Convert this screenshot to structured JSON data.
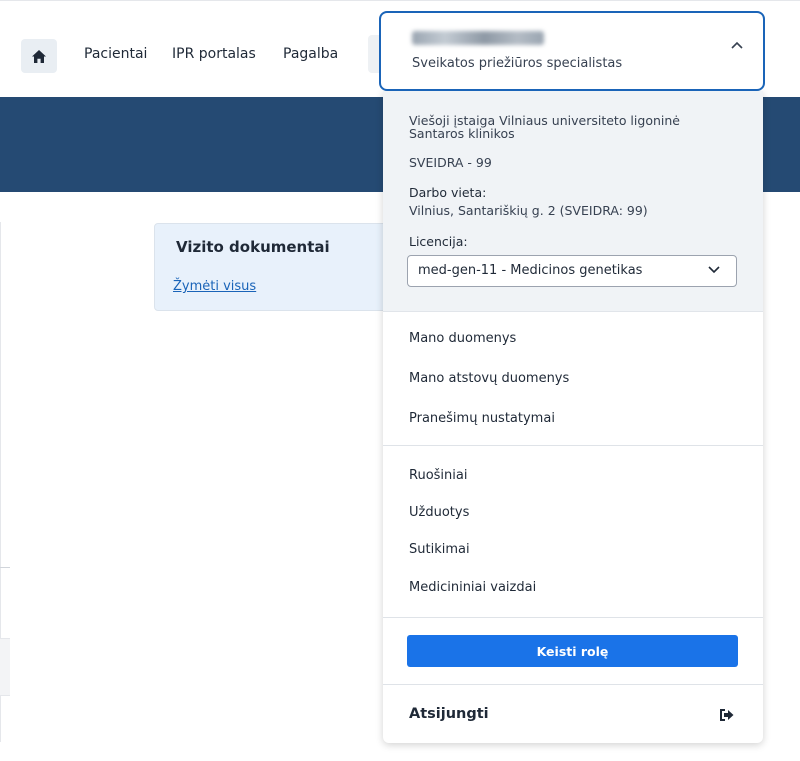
{
  "nav": {
    "home_icon": "home-icon",
    "links": [
      "Pacientai",
      "IPR portalas",
      "Pagalba"
    ]
  },
  "card": {
    "title": "Vizito dokumentai",
    "select_all": "Žymėti visus"
  },
  "user_menu": {
    "role": "Sveikatos priežiūros specialistas",
    "institution": "Viešoji įstaiga Vilniaus universiteto ligoninė Santaros klinikos",
    "sveidra": "SVEIDRA - 99",
    "workplace_label": "Darbo vieta:",
    "workplace_value": "Vilnius, Santariškių g. 2 (SVEIDRA: 99)",
    "license_label": "Licencija:",
    "license_value": "med-gen-11 - Medicinos genetikas",
    "section1": [
      "Mano duomenys",
      "Mano atstovų duomenys",
      "Pranešimų nustatymai"
    ],
    "section2": [
      "Ruošiniai",
      "Užduotys",
      "Sutikimai",
      "Medicininiai vaizdai"
    ],
    "switch_role": "Keisti rolę",
    "logout": "Atsijungti"
  },
  "colors": {
    "hero": "#254a73",
    "accent": "#1a64b8",
    "button": "#1a73e8",
    "card_bg": "#e8f1fb"
  }
}
